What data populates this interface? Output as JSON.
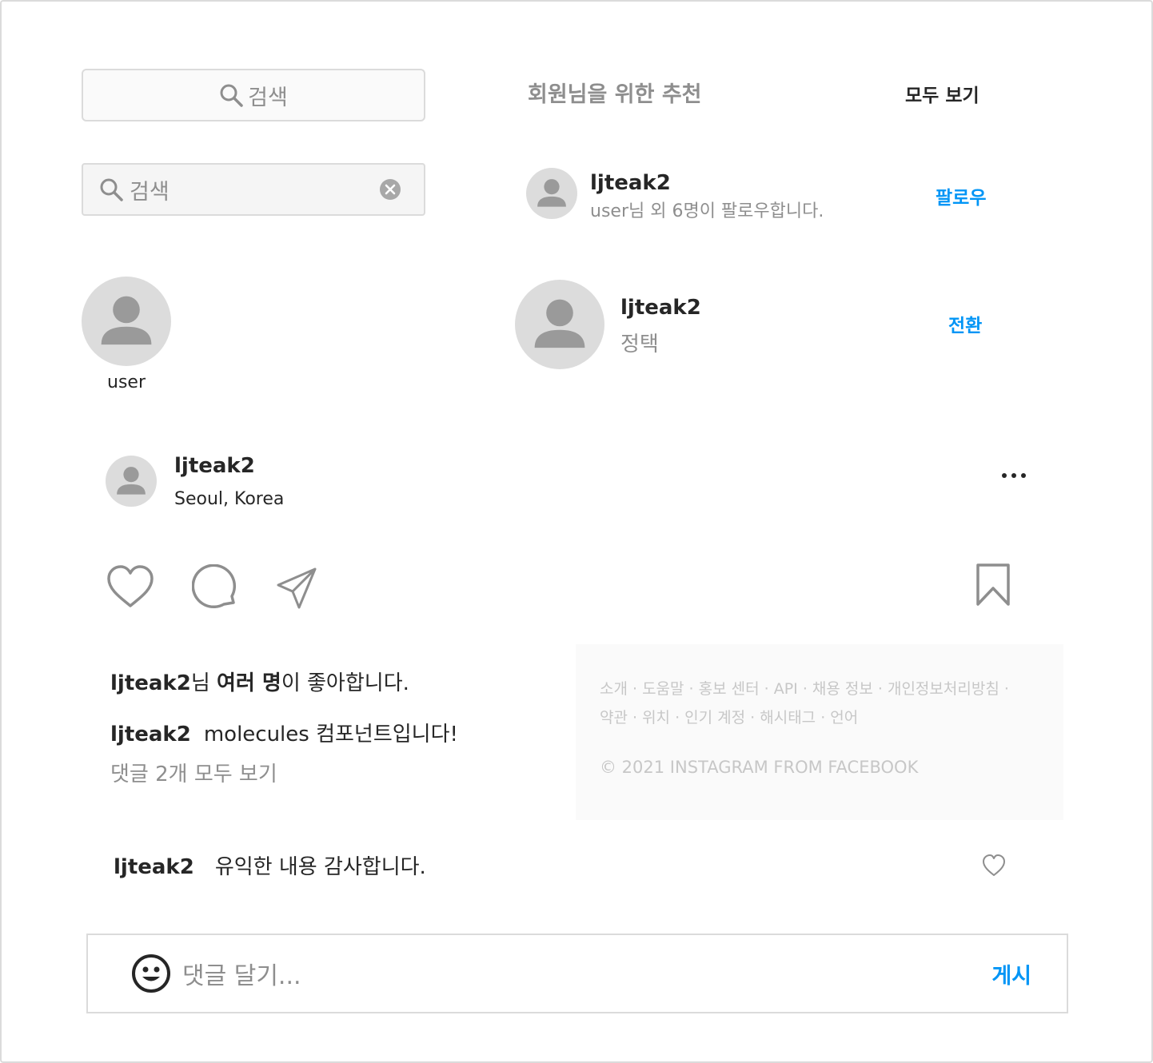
{
  "search_default": {
    "placeholder": "검색",
    "icon": "search-icon"
  },
  "search_focused": {
    "placeholder": "검색",
    "icon": "search-icon",
    "clear_icon": "clear-icon"
  },
  "profile": {
    "username": "user"
  },
  "recommendations": {
    "title": "회원님을 위한 추천",
    "see_all": "모두 보기",
    "suggestion": {
      "username": "ljteak2",
      "subtitle": "user님 외 6명이 팔로우합니다.",
      "action": "팔로우"
    },
    "account": {
      "username": "ljteak2",
      "name": "정택",
      "action": "전환"
    }
  },
  "post": {
    "username": "ljteak2",
    "location": "Seoul, Korea",
    "likes": {
      "user": "ljteak2",
      "suffix1": "님 ",
      "bold": "여러 명",
      "suffix2": "이 좋아합니다."
    },
    "caption": {
      "user": "ljteak2",
      "text": "molecules 컴포넌트입니다!"
    },
    "view_comments": "댓글 2개 모두 보기",
    "comment": {
      "user": "ljteak2",
      "text": "유익한 내용 감사합니다."
    },
    "input": {
      "placeholder": "댓글 달기...",
      "post_label": "게시"
    }
  },
  "footer": {
    "links_line1": "소개 · 도움말 · 홍보 센터 · API · 채용 정보 · 개인정보처리방침 ·",
    "links_line2": "약관 · 위치 · 인기 계정 · 해시태그 · 언어",
    "copyright": "© 2021 INSTAGRAM FROM FACEBOOK"
  },
  "colors": {
    "accent": "#0095f6",
    "muted": "#8e8e8e",
    "avatar_bg": "#dcdcdc",
    "text": "#262626"
  }
}
